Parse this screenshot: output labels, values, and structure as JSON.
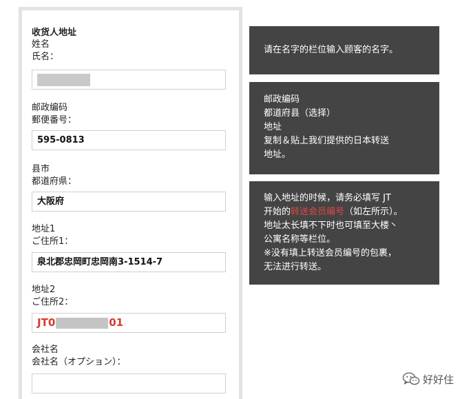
{
  "form": {
    "section_title": "收货人地址",
    "name_label_cn": "姓名",
    "name_label_jp": "氏名：",
    "name_value": "",
    "postal_label_cn": "邮政编码",
    "postal_label_jp": "郵便番号：",
    "postal_value": "595-0813",
    "pref_label_cn": "县市",
    "pref_label_jp": "都道府県：",
    "pref_value": "大阪府",
    "addr1_label_cn": "地址1",
    "addr1_label_jp": "ご住所1：",
    "addr1_value": "泉北郡忠岡町忠岡南3-1514-7",
    "addr2_label_cn": "地址2",
    "addr2_label_jp": "ご住所2：",
    "addr2_prefix": "JT0",
    "addr2_suffix": "01",
    "company_label_cn": "会社名",
    "company_label_jp": "会社名（オプション）：",
    "company_value": ""
  },
  "notes": {
    "note1": "请在名字的栏位输入顾客的名字。",
    "note2_line1": "邮政编码",
    "note2_line2": "都道府县（选择）",
    "note2_line3": "地址",
    "note2_line4": "复制＆贴上我们提供的日本转送",
    "note2_line5": "地址。",
    "note3_line1": "输入地址的时候，请务必填写 JT",
    "note3_line2_pre": "开始的",
    "note3_line2_hl": "转送会员编号",
    "note3_line2_post": "（如左所示）。",
    "note3_line3": "地址太长填不下时也可填至大楼丶",
    "note3_line4": "公寓名称等栏位。",
    "note3_line5": "※没有填上转送会员编号的包裹，",
    "note3_line6": "无法进行转送。"
  },
  "watermark": {
    "text": "好好住",
    "icon": "wechat-icon"
  },
  "colors": {
    "note_bg": "#444444",
    "highlight": "#e0473f",
    "member_id": "#d9382e"
  }
}
